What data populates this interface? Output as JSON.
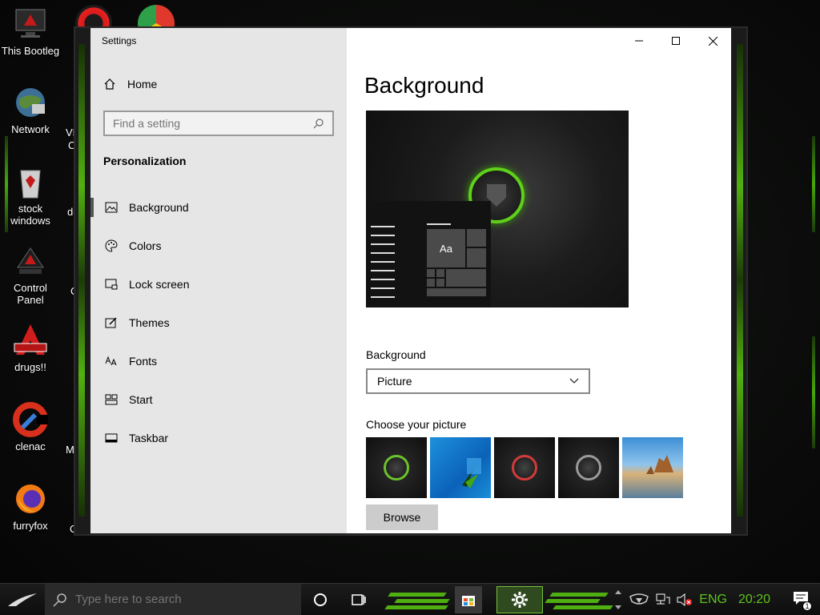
{
  "desktop": {
    "icons": [
      {
        "label_1": "This Bootleg",
        "label_2": ""
      },
      {
        "label_1": "Network",
        "label_2": ""
      },
      {
        "label_1": "stock",
        "label_2": "windows"
      },
      {
        "label_1": "Control",
        "label_2": "Panel"
      },
      {
        "label_1": "drugs!!",
        "label_2": ""
      },
      {
        "label_1": "clenac",
        "label_2": ""
      },
      {
        "label_1": "furryfox",
        "label_2": ""
      }
    ],
    "partial_labels": [
      "VE",
      "C",
      "do",
      "C",
      "M",
      "C"
    ],
    "accent_color": "#4fae10"
  },
  "window": {
    "app_title": "Settings",
    "home_label": "Home",
    "search_placeholder": "Find a setting",
    "section_title": "Personalization",
    "nav_items": [
      {
        "label": "Background",
        "icon": "picture-icon"
      },
      {
        "label": "Colors",
        "icon": "palette-icon"
      },
      {
        "label": "Lock screen",
        "icon": "lock-screen-icon"
      },
      {
        "label": "Themes",
        "icon": "themes-icon"
      },
      {
        "label": "Fonts",
        "icon": "fonts-icon"
      },
      {
        "label": "Start",
        "icon": "start-icon"
      },
      {
        "label": "Taskbar",
        "icon": "taskbar-icon"
      }
    ],
    "active_item": "Background"
  },
  "content": {
    "page_title": "Background",
    "preview_tile_text": "Aa",
    "background_label": "Background",
    "background_value": "Picture",
    "choose_label": "Choose your picture",
    "browse_label": "Browse"
  },
  "taskbar": {
    "search_placeholder": "Type here to search",
    "language": "ENG",
    "time": "20:20",
    "notification_count": "1"
  }
}
